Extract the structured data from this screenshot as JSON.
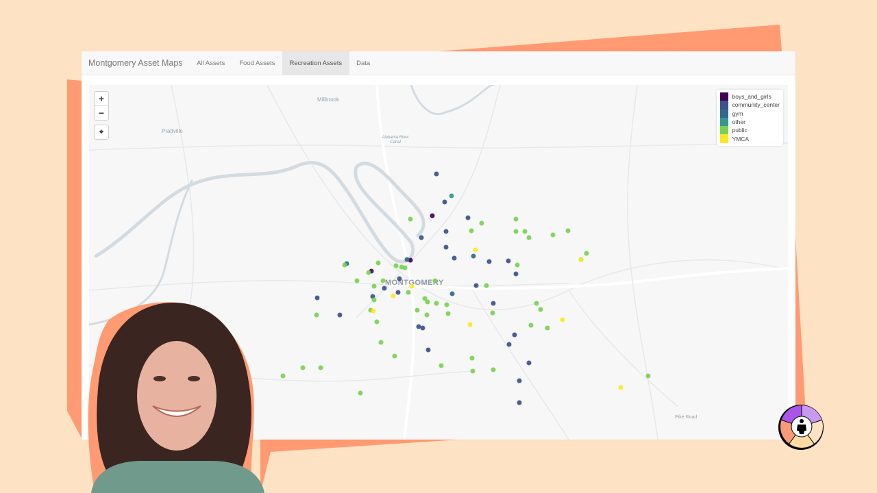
{
  "app": {
    "brand": "Montgomery Asset Maps",
    "tabs": [
      {
        "label": "All Assets",
        "active": false
      },
      {
        "label": "Food Assets",
        "active": false
      },
      {
        "label": "Recreation Assets",
        "active": true
      },
      {
        "label": "Data",
        "active": false
      }
    ]
  },
  "map": {
    "controls": {
      "zoom_in": "+",
      "zoom_out": "−",
      "locate": "⌖"
    },
    "place_labels": {
      "millbrook": "Millbrook",
      "prattville": "Prattville",
      "canal": "Alabama River Canal",
      "montgomery": "MONTGOMERY",
      "pike_road": "Pike Road"
    },
    "legend": [
      {
        "key": "boys_and_girls",
        "label": "boys_and_girls",
        "color": "#440154"
      },
      {
        "key": "community_center",
        "label": "community_center",
        "color": "#3b528b"
      },
      {
        "key": "gym",
        "label": "gym",
        "color": "#31688e"
      },
      {
        "key": "other",
        "label": "other",
        "color": "#35978f"
      },
      {
        "key": "public",
        "label": "public",
        "color": "#7ad151"
      },
      {
        "key": "YMCA",
        "label": "YMCA",
        "color": "#fde725"
      }
    ],
    "markers": {
      "boys_and_girls": [
        [
          49.1,
          36.9
        ],
        [
          40.4,
          52.5
        ],
        [
          46.0,
          49.4
        ]
      ],
      "community_center": [
        [
          49.7,
          25.0
        ],
        [
          50.9,
          33.0
        ],
        [
          54.2,
          37.5
        ],
        [
          51.1,
          41.3
        ],
        [
          47.5,
          43.1
        ],
        [
          51.1,
          45.7
        ],
        [
          52.3,
          48.8
        ],
        [
          57.3,
          49.9
        ],
        [
          60.0,
          49.7
        ],
        [
          61.1,
          53.2
        ],
        [
          44.4,
          54.6
        ],
        [
          42.3,
          57.4
        ],
        [
          44.2,
          58.5
        ],
        [
          40.6,
          59.6
        ],
        [
          55.4,
          56.5
        ],
        [
          32.6,
          60.1
        ],
        [
          35.9,
          64.9
        ],
        [
          57.8,
          61.6
        ],
        [
          47.2,
          68.1
        ],
        [
          47.7,
          68.5
        ],
        [
          60.9,
          70.4
        ],
        [
          60.1,
          73.2
        ],
        [
          48.5,
          74.8
        ],
        [
          62.9,
          78.3
        ],
        [
          61.6,
          83.4
        ],
        [
          61.6,
          89.6
        ]
      ],
      "gym": [
        [
          36.9,
          50.3
        ],
        [
          45.5,
          49.3
        ],
        [
          55.0,
          48.2
        ],
        [
          52.0,
          58.8
        ]
      ],
      "other": [
        [
          51.9,
          31.3
        ]
      ],
      "public": [
        [
          46.0,
          37.9
        ],
        [
          54.7,
          41.2
        ],
        [
          56.2,
          38.9
        ],
        [
          61.1,
          37.9
        ],
        [
          61.1,
          41.4
        ],
        [
          62.4,
          41.4
        ],
        [
          62.9,
          43.1
        ],
        [
          66.4,
          42.3
        ],
        [
          68.5,
          41.2
        ],
        [
          71.2,
          47.4
        ],
        [
          70.4,
          49.2
        ],
        [
          61.3,
          50.7
        ],
        [
          36.6,
          50.8
        ],
        [
          41.4,
          50.2
        ],
        [
          43.9,
          50.9
        ],
        [
          44.7,
          51.3
        ],
        [
          45.2,
          51.5
        ],
        [
          40.0,
          52.9
        ],
        [
          38.3,
          55.3
        ],
        [
          42.1,
          55.2
        ],
        [
          49.5,
          55.3
        ],
        [
          56.9,
          56.5
        ],
        [
          40.8,
          56.8
        ],
        [
          45.7,
          58.5
        ],
        [
          40.8,
          60.7
        ],
        [
          48.0,
          60.3
        ],
        [
          48.4,
          61.2
        ],
        [
          49.7,
          61.6
        ],
        [
          51.2,
          61.9
        ],
        [
          47.0,
          63.5
        ],
        [
          32.5,
          64.8
        ],
        [
          40.3,
          63.5
        ],
        [
          48.3,
          64.9
        ],
        [
          51.4,
          64.4
        ],
        [
          57.7,
          64.2
        ],
        [
          64.0,
          61.5
        ],
        [
          64.6,
          63.4
        ],
        [
          41.2,
          66.8
        ],
        [
          63.2,
          67.8
        ],
        [
          65.6,
          68.6
        ],
        [
          41.8,
          72.5
        ],
        [
          43.7,
          76.4
        ],
        [
          54.8,
          77.1
        ],
        [
          50.4,
          79.2
        ],
        [
          54.9,
          80.6
        ],
        [
          57.8,
          80.4
        ],
        [
          27.7,
          82.0
        ],
        [
          30.6,
          79.7
        ],
        [
          33.1,
          79.7
        ],
        [
          38.8,
          86.9
        ],
        [
          80.0,
          82.1
        ]
      ],
      "YMCA": [
        [
          55.3,
          46.5
        ],
        [
          46.2,
          56.7
        ],
        [
          43.5,
          59.4
        ],
        [
          40.7,
          63.8
        ],
        [
          70.4,
          49.2
        ],
        [
          54.5,
          67.6
        ],
        [
          67.7,
          66.3
        ],
        [
          76.1,
          85.4
        ]
      ]
    }
  },
  "branding": {
    "logo": "person-wheel-logo",
    "photo": "presenter-photo"
  }
}
